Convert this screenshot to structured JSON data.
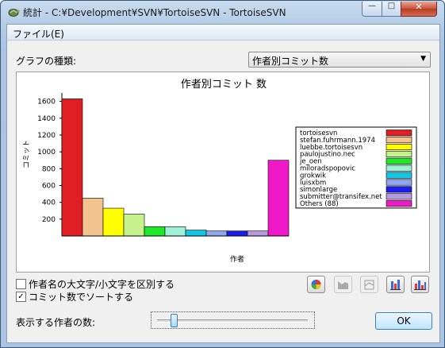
{
  "window": {
    "title": "統計 - C:¥Development¥SVN¥TortoiseSVN - TortoiseSVN",
    "minimize_glyph": "—",
    "maximize_glyph": "□",
    "close_glyph": "✕"
  },
  "menu": {
    "file": "ファイル(E)"
  },
  "graph_type": {
    "label": "グラフの種類:",
    "selected": "作者別コミット数"
  },
  "chart_data": {
    "type": "bar",
    "title": "作者別コミット 数",
    "xlabel": "作者",
    "ylabel": "コミット",
    "ylim": [
      0,
      1700
    ],
    "yticks": [
      200,
      400,
      600,
      800,
      1000,
      1200,
      1400,
      1600
    ],
    "categories": [
      "tortoisesvn",
      "stefan.fuhrmann.1974",
      "luebbe.tortoisesvn",
      "paulojustino.nec",
      "je_oen",
      "milorad­spopovic",
      "grokwik",
      "luisxbm",
      "simonlarge",
      "submitter@transifex.net",
      "Others (88)"
    ],
    "legend_labels": [
      "tortoisesvn",
      "stefan.fuhrmann.1974",
      "luebbe.tortoisesvn",
      "paulojustino.nec",
      "je_oen",
      "miloradspopovic",
      "grokwik",
      "luisxbm",
      "simonlarge",
      "submitter@transifex.net",
      "Others (88)"
    ],
    "values": [
      1630,
      450,
      330,
      260,
      110,
      110,
      70,
      60,
      60,
      60,
      900
    ],
    "colors": [
      "#e01f25",
      "#f2c28f",
      "#ffff00",
      "#c5f28c",
      "#1ee82a",
      "#9ff0d6",
      "#13c6e6",
      "#8ea6ee",
      "#1d1cf0",
      "#b69ae0",
      "#f019c8"
    ],
    "legend_position": "right"
  },
  "options": {
    "case_sensitive": {
      "label": "作者名の大文字/小文字を区別する",
      "checked": false
    },
    "sort_by_commits": {
      "label": "コミット数でソートする",
      "checked": true
    }
  },
  "authors_count": {
    "label": "表示する作者の数:",
    "value_fraction": 0.1
  },
  "ok_button": "OK"
}
